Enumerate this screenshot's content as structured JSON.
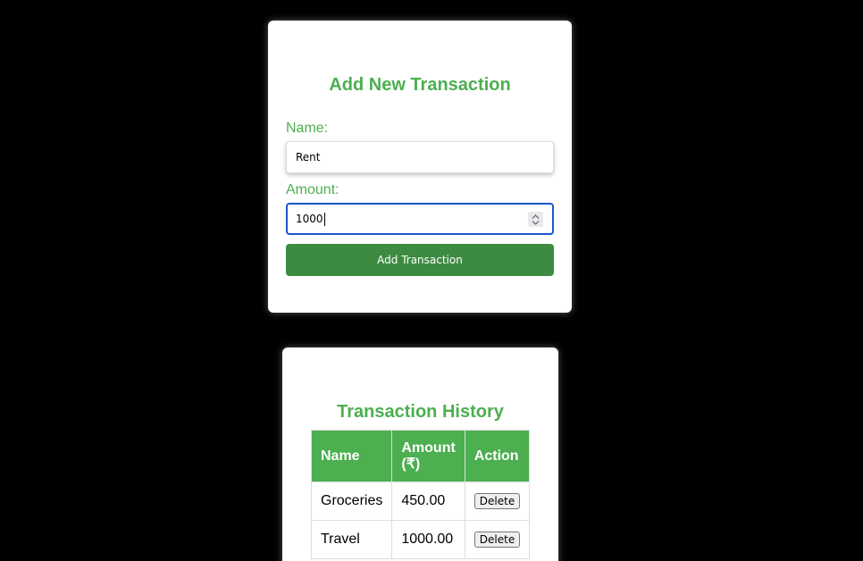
{
  "form": {
    "title": "Add New Transaction",
    "name_label": "Name:",
    "name_value": "Rent",
    "amount_label": "Amount:",
    "amount_value": "1000",
    "submit_label": "Add Transaction"
  },
  "history": {
    "title": "Transaction History",
    "columns": [
      "Name",
      "Amount (₹)",
      "Action"
    ],
    "rows": [
      {
        "name": "Groceries",
        "amount": "450.00",
        "action": "Delete"
      },
      {
        "name": "Travel",
        "amount": "1000.00",
        "action": "Delete"
      }
    ]
  },
  "colors": {
    "accent": "#4caf50",
    "button": "#3d8b40",
    "focus_border": "#1a57c9",
    "background": "#000000"
  }
}
